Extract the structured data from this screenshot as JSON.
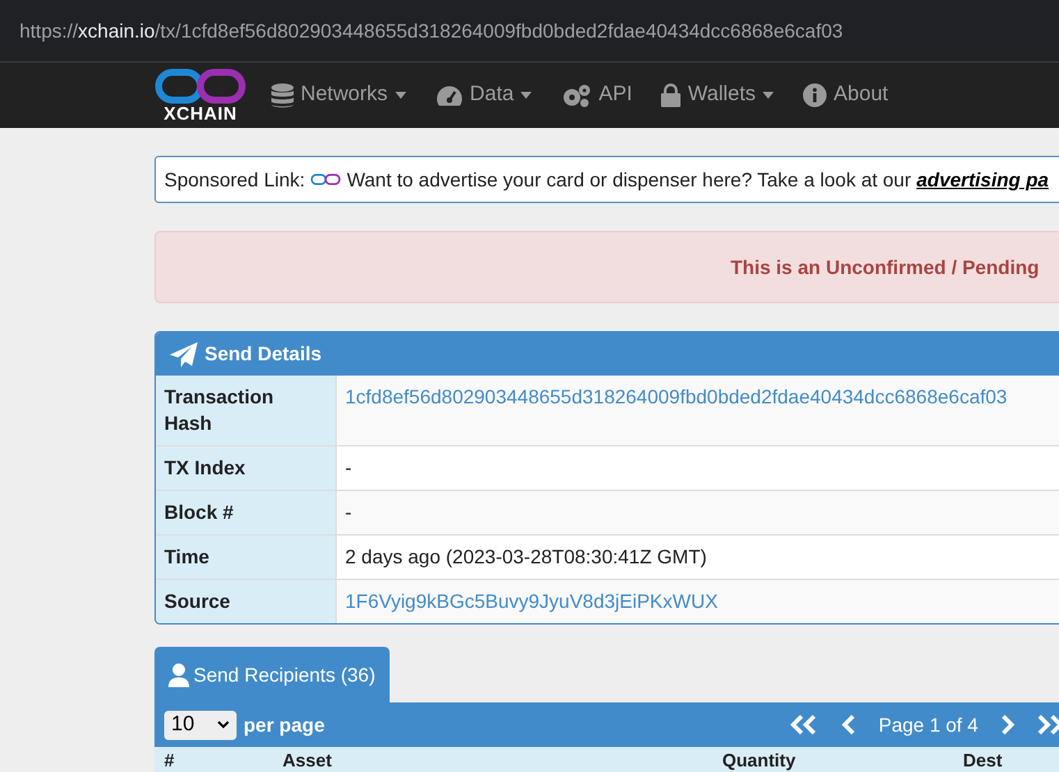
{
  "address_bar": {
    "url_host_prefix": "https://",
    "url_host": "xchain.io",
    "url_path": "/tx/1cfd8ef56d802903448655d318264009fbd0bded2fdae40434dcc6868e6caf03"
  },
  "navbar": {
    "logo_text": "XCHAIN",
    "items": [
      {
        "label": "Networks",
        "dropdown": true
      },
      {
        "label": "Data",
        "dropdown": true
      },
      {
        "label": "API",
        "dropdown": false
      },
      {
        "label": "Wallets",
        "dropdown": true
      },
      {
        "label": "About",
        "dropdown": false
      }
    ]
  },
  "sponsored": {
    "label": "Sponsored Link:",
    "text": "Want to advertise your card or dispenser here? Take a look at our",
    "link": "advertising pa"
  },
  "alert": {
    "text": "This is an Unconfirmed / Pending"
  },
  "send_details": {
    "title": "Send Details",
    "rows": [
      {
        "label": "Transaction Hash",
        "value": "1cfd8ef56d802903448655d318264009fbd0bded2fdae40434dcc6868e6caf03",
        "kind": "link"
      },
      {
        "label": "TX Index",
        "value": "-",
        "kind": "text"
      },
      {
        "label": "Block #",
        "value": "-",
        "kind": "text"
      },
      {
        "label": "Time",
        "value": "2 days ago (2023-03-28T08:30:41Z GMT)",
        "kind": "text"
      },
      {
        "label": "Source",
        "value": "1F6Vyig9kBGc5Buvy9JyuV8d3jEiPKxWUX",
        "kind": "link"
      }
    ]
  },
  "recipients": {
    "tab": "Send Recipients (36)",
    "per_page_value": "10",
    "per_page_label": "per page",
    "page_text": "Page 1 of 4",
    "columns": [
      "#",
      "Asset",
      "Quantity",
      "Dest"
    ]
  }
}
